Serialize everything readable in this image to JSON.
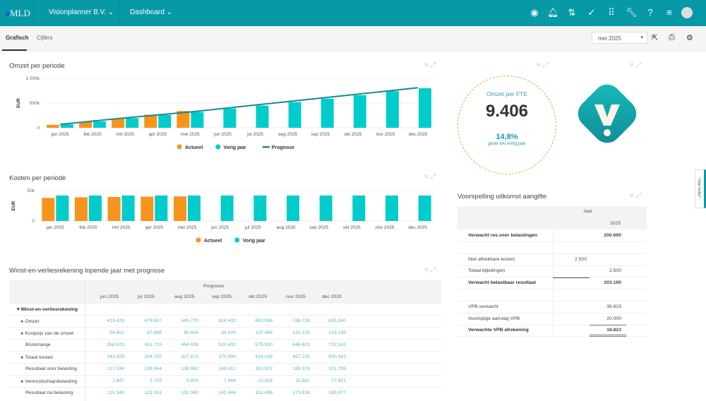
{
  "header": {
    "logo": "MLD",
    "company": "Visionplanner B.V.",
    "page": "Dashboard",
    "icons": [
      "eye-icon",
      "bell-icon",
      "workflow-icon",
      "check-circle-icon",
      "apps-grid-icon",
      "wrench-icon",
      "help-icon",
      "menu-icon"
    ]
  },
  "tabs": [
    {
      "label": "Grafisch",
      "active": true
    },
    {
      "label": "Cijfers",
      "active": false
    }
  ],
  "period": {
    "selected": "mei 2025"
  },
  "side_tab": "Hulp nodig?",
  "colors": {
    "brand": "#0899a6",
    "actueel": "#f7941d",
    "vorig_jaar": "#00cccc",
    "prognose": "#1a8a8f",
    "kpi_border": "#e0a640"
  },
  "omzet": {
    "title": "Omzet per periode"
  },
  "kosten": {
    "title": "Kosten per periode"
  },
  "chart_data": [
    {
      "type": "bar",
      "title": "Omzet per periode",
      "ylabel": "EUR",
      "ylim": [
        0,
        1000000
      ],
      "yticks": [
        "0",
        "500k",
        "1 000k"
      ],
      "legend": "bottom",
      "categories": [
        "jan 2025",
        "feb 2025",
        "mrt 2025",
        "apr 2025",
        "mei 2025",
        "jun 2025",
        "jul 2025",
        "aug 2025",
        "sep 2025",
        "okt 2025",
        "nov 2025",
        "dec 2025"
      ],
      "series": [
        {
          "name": "Actueel",
          "type": "bar",
          "values": [
            60000,
            120000,
            190000,
            265000,
            340000,
            null,
            null,
            null,
            null,
            null,
            null,
            null
          ]
        },
        {
          "name": "Vorig jaar",
          "type": "bar",
          "values": [
            70000,
            130000,
            195000,
            260000,
            320000,
            390000,
            450000,
            520000,
            590000,
            660000,
            740000,
            800000
          ]
        },
        {
          "name": "Prognose",
          "type": "line",
          "values": [
            70000,
            135000,
            200000,
            260000,
            320000,
            390000,
            460000,
            530000,
            600000,
            670000,
            740000,
            810000
          ]
        }
      ]
    },
    {
      "type": "bar",
      "title": "Kosten per periode",
      "ylabel": "EUR",
      "ylim": [
        0,
        50000
      ],
      "yticks": [
        "0",
        "50k"
      ],
      "legend": "bottom",
      "categories": [
        "jan 2025",
        "feb 2025",
        "mrt 2025",
        "apr 2025",
        "mei 2025",
        "jun 2025",
        "jul 2025",
        "aug 2025",
        "sep 2025",
        "okt 2025",
        "nov 2025",
        "dec 2025"
      ],
      "series": [
        {
          "name": "Actueel",
          "type": "bar",
          "values": [
            38000,
            39000,
            39500,
            40000,
            40500,
            null,
            null,
            null,
            null,
            null,
            null,
            null
          ]
        },
        {
          "name": "Vorig jaar",
          "type": "bar",
          "values": [
            42000,
            42000,
            42000,
            42000,
            42000,
            42000,
            42000,
            42000,
            42000,
            42000,
            42000,
            42000
          ]
        }
      ]
    }
  ],
  "kpi": {
    "label": "Omzet per FTE",
    "value": "9.406",
    "growth": "14,8%",
    "growth_label": "groei tov vorig jaar"
  },
  "pl": {
    "title": "Winst-en-verliesrekening lopende jaar met prognose",
    "group": "Prognose",
    "columns": [
      "jun 2025",
      "jul 2025",
      "aug 2025",
      "sep 2025",
      "okt 2025",
      "nov 2025",
      "dec 2025"
    ],
    "section": "Winst-en-verliesrekening",
    "rows": [
      {
        "label": "Omzet",
        "expand": true,
        "values": [
          "413.425",
          "479.587",
          "545.770",
          "614.402",
          "682.996",
          "766.738",
          "835.340"
        ]
      },
      {
        "label": "Kostprijs van de omzet",
        "expand": true,
        "values": [
          "54.802",
          "67.868",
          "80.934",
          "94.000",
          "107.066",
          "120.132",
          "133.198"
        ]
      },
      {
        "label": "Brutomarge",
        "expand": false,
        "values": [
          "358.623",
          "411.719",
          "464.836",
          "520.402",
          "575.930",
          "646.603",
          "702.142"
        ]
      },
      {
        "label": "Totaal kosten",
        "expand": true,
        "values": [
          "241.429",
          "284.755",
          "327.873",
          "370.990",
          "414.108",
          "457.225",
          "500.343"
        ]
      },
      {
        "label": "Resultaat voor belasting",
        "expand": false,
        "values": [
          "117.194",
          "126.964",
          "136.963",
          "149.412",
          "161.822",
          "189.378",
          "201.799"
        ]
      },
      {
        "label": "Vennootschapsbelasting",
        "expand": true,
        "values": [
          "1.847",
          "3.703",
          "5.603",
          "7.968",
          "10.326",
          "15.562",
          "17.921"
        ]
      },
      {
        "label": "Resultaat na belasting",
        "expand": false,
        "values": [
          "115.348",
          "123.261",
          "131.360",
          "141.444",
          "151.496",
          "173.816",
          "183.877"
        ]
      }
    ]
  },
  "vpb": {
    "title": "Voorspelling uitkomst aangifte",
    "group": "Jaar",
    "year": "2025",
    "rows": [
      {
        "label": "Verwacht res.voor belastingen",
        "bold": true,
        "mid": "",
        "value": "200.690"
      },
      {
        "label": "",
        "bold": false,
        "mid": "",
        "value": ""
      },
      {
        "label": "Niet aftrekbare kosten",
        "bold": false,
        "mid": "2.500",
        "value": ""
      },
      {
        "label": "Totaal bijtellingen",
        "bold": false,
        "mid": "",
        "value": "2.500"
      },
      {
        "label": "Verwacht belastbaar resultaat",
        "bold": true,
        "mid": "",
        "value": "203.190"
      },
      {
        "label": "",
        "bold": false,
        "mid": "",
        "value": ""
      },
      {
        "label": "VPB verwacht",
        "bold": false,
        "mid": "",
        "value": "38.823"
      },
      {
        "label": "Voorlopige aanslag VPB",
        "bold": false,
        "mid": "",
        "value": "20.000"
      },
      {
        "label": "Verwachte VPB afrekening",
        "bold": true,
        "mid": "",
        "value": "18.823"
      }
    ]
  }
}
